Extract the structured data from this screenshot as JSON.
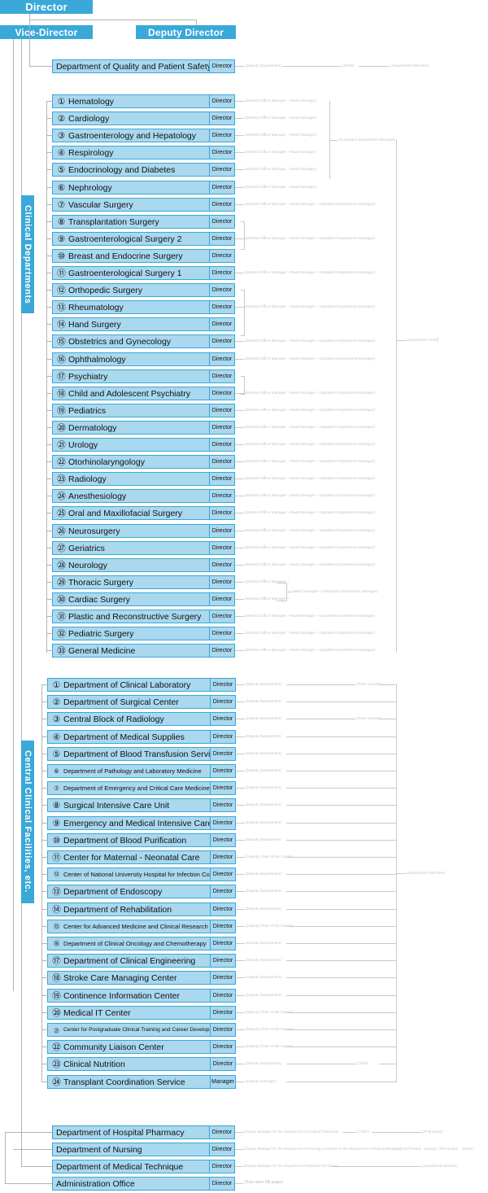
{
  "header": {
    "director": "Director",
    "vice_director": "Vice-Director",
    "deputy_director": "Deputy Director"
  },
  "roles": {
    "director": "Director",
    "manager": "Manager"
  },
  "annotations": {
    "deputy_department": "(Deputy Department)",
    "grm": "(GRM)",
    "department_member": "(Department Member)",
    "medical_ward": "(Medical Office Manager・Ward Manager)",
    "medical_ward_outpatient": "(Medical Office Manager・Ward Manager・Outpatient Department Manager)",
    "outpatient_department_manager": "(Outpatient Department Manager)",
    "ward_outpatient": "(Ward Manager・Outpatient Department Manager)",
    "department_staff": "(Department Staff)",
    "team_leader": "(Team Leader)",
    "deputy_chief_center": "(Deputy Chief of the Center)",
    "deputy_manager": "(Deputy manager)",
    "chief": "(Chief)",
    "pharmacy_deputy": "(Deputy Manager for the Department of Hospital Pharmacy)",
    "pharmacy_chief": "(Chief )",
    "pharmacist": "(Pharmacist)",
    "nursing_deputy": "(Deputy Manager for the Department of Nursing)",
    "nursing_assistant": "(Assistant to the Department of Nursing Manager)",
    "nursing_chief": "(Chief Nurse)",
    "nursing_deputy_chief": "(Deputy Chief Nurse)",
    "nurse": "(Nurse)",
    "medical_technique_deputy": "(Deputy Manager for the Department of Medical Technique)",
    "see_also": "(See also 08 page)"
  },
  "groups": {
    "clinical_departments_label": "Clinical Departments",
    "central_clinical_label": "Central Clinical Facilities, etc."
  },
  "quality_safety": {
    "name": "Department of Quality and Patient Safety",
    "role": "Director"
  },
  "clinical_departments": [
    {
      "num": "①",
      "name": "Hematology",
      "role": "Director",
      "note": "medical_ward"
    },
    {
      "num": "②",
      "name": "Cardiology",
      "role": "Director",
      "note": "medical_ward"
    },
    {
      "num": "③",
      "name": "Gastroenterology and Hepatology",
      "role": "Director",
      "note": "medical_ward"
    },
    {
      "num": "④",
      "name": "Respirology",
      "role": "Director",
      "note": "medical_ward"
    },
    {
      "num": "⑤",
      "name": "Endocrinology and Diabetes",
      "role": "Director",
      "note": "medical_ward"
    },
    {
      "num": "⑥",
      "name": "Nephrology",
      "role": "Director",
      "note": "medical_ward"
    },
    {
      "num": "⑦",
      "name": "Vascular Surgery",
      "role": "Director",
      "note": "medical_ward_outpatient"
    },
    {
      "num": "⑧",
      "name": "Transplantation Surgery",
      "role": "Director",
      "note": ""
    },
    {
      "num": "⑨",
      "name": "Gastroenterological Surgery 2",
      "role": "Director",
      "note": "medical_ward_outpatient"
    },
    {
      "num": "⑩",
      "name": "Breast and Endocrine Surgery",
      "role": "Director",
      "note": ""
    },
    {
      "num": "⑪",
      "name": "Gastroenterological Surgery 1",
      "role": "Director",
      "note": "medical_ward_outpatient"
    },
    {
      "num": "⑫",
      "name": "Orthopedic Surgery",
      "role": "Director",
      "note": ""
    },
    {
      "num": "⑬",
      "name": "Rheumatology",
      "role": "Director",
      "note": "medical_ward_outpatient"
    },
    {
      "num": "⑭",
      "name": "Hand Surgery",
      "role": "Director",
      "note": ""
    },
    {
      "num": "⑮",
      "name": "Obstetrics and Gynecology",
      "role": "Director",
      "note": "medical_ward_outpatient"
    },
    {
      "num": "⑯",
      "name": "Ophthalmology",
      "role": "Director",
      "note": "medical_ward_outpatient"
    },
    {
      "num": "⑰",
      "name": "Psychiatry",
      "role": "Director",
      "note": ""
    },
    {
      "num": "⑱",
      "name": "Child and Adolescent Psychiatry",
      "role": "Director",
      "note": "medical_ward_outpatient"
    },
    {
      "num": "⑲",
      "name": "Pediatrics",
      "role": "Director",
      "note": "medical_ward_outpatient"
    },
    {
      "num": "⑳",
      "name": "Dermatology",
      "role": "Director",
      "note": "medical_ward_outpatient"
    },
    {
      "num": "㉑",
      "name": "Urology",
      "role": "Director",
      "note": "medical_ward_outpatient"
    },
    {
      "num": "㉒",
      "name": "Otorhinolaryngology",
      "role": "Director",
      "note": "medical_ward_outpatient"
    },
    {
      "num": "㉓",
      "name": "Radiology",
      "role": "Director",
      "note": "medical_ward_outpatient"
    },
    {
      "num": "㉔",
      "name": "Anesthesiology",
      "role": "Director",
      "note": "medical_ward_outpatient"
    },
    {
      "num": "㉕",
      "name": "Oral and Maxillofacial Surgery",
      "role": "Director",
      "note": "medical_ward_outpatient"
    },
    {
      "num": "㉖",
      "name": "Neurosurgery",
      "role": "Director",
      "note": "medical_ward_outpatient"
    },
    {
      "num": "㉗",
      "name": "Geriatrics",
      "role": "Director",
      "note": "medical_ward_outpatient"
    },
    {
      "num": "㉘",
      "name": "Neurology",
      "role": "Director",
      "note": "medical_ward_outpatient"
    },
    {
      "num": "㉙",
      "name": "Thoracic Surgery",
      "role": "Director",
      "note": "medical_office_manager"
    },
    {
      "num": "㉚",
      "name": "Cardiac Surgery",
      "role": "Director",
      "note": "medical_office_manager"
    },
    {
      "num": "㉛",
      "name": "Plastic and Reconstructive Surgery",
      "role": "Director",
      "note": "medical_ward_outpatient"
    },
    {
      "num": "㉜",
      "name": "Pediatric Surgery",
      "role": "Director",
      "note": "medical_ward_outpatient"
    },
    {
      "num": "㉝",
      "name": "General Medicine",
      "role": "Director",
      "note": "medical_ward_outpatient"
    }
  ],
  "central_clinical": [
    {
      "num": "①",
      "name": "Department of Clinical Laboratory",
      "role": "Director",
      "note": "deputy_department",
      "extra": "team_leader"
    },
    {
      "num": "②",
      "name": "Department of Surgical Center",
      "role": "Director",
      "note": "deputy_department",
      "extra": ""
    },
    {
      "num": "③",
      "name": "Central Block of Radiology",
      "role": "Director",
      "note": "deputy_department",
      "extra": "team_leader"
    },
    {
      "num": "④",
      "name": "Department of Medical Supplies",
      "role": "Director",
      "note": "deputy_department",
      "extra": ""
    },
    {
      "num": "⑤",
      "name": "Department of Blood Transfusion Service",
      "role": "Director",
      "note": "deputy_department",
      "extra": ""
    },
    {
      "num": "⑥",
      "name": "Department of Pathology and Laboratory Medicine",
      "role": "Director",
      "note": "deputy_department",
      "extra": ""
    },
    {
      "num": "⑦",
      "name": "Department of Emergency and Critical Care Medicine",
      "role": "Director",
      "note": "deputy_department",
      "extra": ""
    },
    {
      "num": "⑧",
      "name": "Surgical Intensive Care Unit",
      "role": "Director",
      "note": "deputy_department",
      "extra": ""
    },
    {
      "num": "⑨",
      "name": "Emergency and Medical Intensive Care Unit",
      "role": "Director",
      "note": "deputy_department",
      "extra": ""
    },
    {
      "num": "⑩",
      "name": "Department of Blood Purification",
      "role": "Director",
      "note": "deputy_department",
      "extra": ""
    },
    {
      "num": "⑪",
      "name": "Center for Maternal - Neonatal Care",
      "role": "Director",
      "note": "deputy_chief_center",
      "extra": ""
    },
    {
      "num": "⑫",
      "name": "Center of National University Hospital for Infection Control",
      "role": "Director",
      "note": "deputy_department",
      "extra": ""
    },
    {
      "num": "⑬",
      "name": "Department of Endoscopy",
      "role": "Director",
      "note": "deputy_department",
      "extra": ""
    },
    {
      "num": "⑭",
      "name": "Department of Rehabilitation",
      "role": "Director",
      "note": "deputy_department",
      "extra": ""
    },
    {
      "num": "⑮",
      "name": "Center for Advanced Medicine and Clinical Research",
      "role": "Director",
      "note": "deputy_chief_center",
      "extra": ""
    },
    {
      "num": "⑯",
      "name": "Department of Clinical Oncology and Chemotherapy",
      "role": "Director",
      "note": "deputy_department",
      "extra": ""
    },
    {
      "num": "⑰",
      "name": "Department of Clinical Engineering",
      "role": "Director",
      "note": "deputy_department",
      "extra": ""
    },
    {
      "num": "⑱",
      "name": "Stroke Care Managing Center",
      "role": "Director",
      "note": "deputy_department",
      "extra": ""
    },
    {
      "num": "⑲",
      "name": "Continence Information Center",
      "role": "Director",
      "note": "deputy_department",
      "extra": ""
    },
    {
      "num": "⑳",
      "name": "Medical IT Center",
      "role": "Director",
      "note": "deputy_chief_center",
      "extra": ""
    },
    {
      "num": "㉑",
      "name": "Center for Postgraduate Clinical Training and Career Development",
      "role": "Director",
      "note": "deputy_chief_center",
      "extra": ""
    },
    {
      "num": "㉒",
      "name": "Community Liaison Center",
      "role": "Director",
      "note": "deputy_chief_center",
      "extra": ""
    },
    {
      "num": "㉓",
      "name": "Clinical Nutrition",
      "role": "Director",
      "note": "deputy_department",
      "extra": "chief"
    },
    {
      "num": "㉔",
      "name": "Transplant Coordination Service",
      "role": "Manager",
      "note": "deputy_manager",
      "extra": ""
    }
  ],
  "bottom": [
    {
      "name": "Department of Hospital Pharmacy",
      "role": "Director"
    },
    {
      "name": "Department of Nursing",
      "role": "Director"
    },
    {
      "name": "Department of Medical Technique",
      "role": "Director"
    },
    {
      "name": "Administration Office",
      "role": "Director"
    }
  ],
  "colors": {
    "brand": "#3aa8d8",
    "box_fill": "#a9d8ef",
    "line": "#b3b3b3",
    "faint_text": "#c4c4c4"
  }
}
